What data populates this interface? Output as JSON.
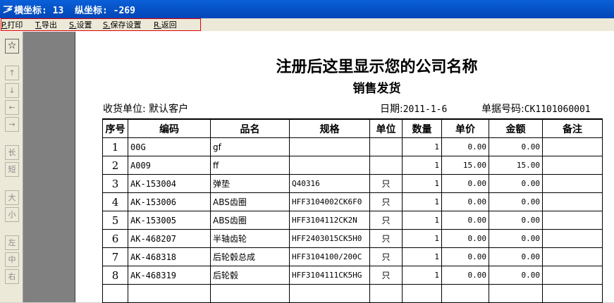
{
  "titlebar": {
    "text": "横坐标: 13  纵坐标: -269"
  },
  "menu": [
    {
      "key": "P.",
      "label": "打印"
    },
    {
      "key": "T.",
      "label": "导出"
    },
    {
      "key": "S.",
      "label": "设置"
    },
    {
      "key": "S.",
      "label": "保存设置"
    },
    {
      "key": "R.",
      "label": "返回"
    }
  ],
  "toolbox": {
    "star": "☆",
    "up": "↑",
    "down": "↓",
    "left": "←",
    "right": "→",
    "long": "长",
    "short": "短",
    "big": "大",
    "small": "小",
    "align_left": "左",
    "align_center": "中",
    "align_right": "右"
  },
  "doc": {
    "company": "注册后这里显示您的公司名称",
    "title": "销售发货",
    "receiver_label": "收货单位:",
    "receiver": "默认客户",
    "date_label": "日期:",
    "date": "2011-1-6",
    "docno_label": "单据号码:",
    "docno": "CK1101060001"
  },
  "table": {
    "headers": [
      "序号",
      "编码",
      "品名",
      "规格",
      "单位",
      "数量",
      "单价",
      "金额",
      "备注"
    ],
    "rows": [
      {
        "no": "1",
        "code": "00G",
        "name": "gf",
        "spec": "",
        "unit": "",
        "qty": "1",
        "price": "0.00",
        "amount": "0.00",
        "note": ""
      },
      {
        "no": "2",
        "code": "A009",
        "name": "ff",
        "spec": "",
        "unit": "",
        "qty": "1",
        "price": "15.00",
        "amount": "15.00",
        "note": ""
      },
      {
        "no": "3",
        "code": "AK-153004",
        "name": "弹垫",
        "spec": "Q40316",
        "unit": "只",
        "qty": "1",
        "price": "0.00",
        "amount": "0.00",
        "note": ""
      },
      {
        "no": "4",
        "code": "AK-153006",
        "name": "ABS齿圈",
        "spec": "HFF3104002CK6F0",
        "unit": "只",
        "qty": "1",
        "price": "0.00",
        "amount": "0.00",
        "note": ""
      },
      {
        "no": "5",
        "code": "AK-153005",
        "name": "ABS齿圈",
        "spec": "HFF3104112CK2N",
        "unit": "只",
        "qty": "1",
        "price": "0.00",
        "amount": "0.00",
        "note": ""
      },
      {
        "no": "6",
        "code": "AK-468207",
        "name": "半轴齿轮",
        "spec": "HFF2403015CK5H0",
        "unit": "只",
        "qty": "1",
        "price": "0.00",
        "amount": "0.00",
        "note": ""
      },
      {
        "no": "7",
        "code": "AK-468318",
        "name": "后轮毂总成",
        "spec": "HFF3104100/200C",
        "unit": "只",
        "qty": "1",
        "price": "0.00",
        "amount": "0.00",
        "note": ""
      },
      {
        "no": "8",
        "code": "AK-468319",
        "name": "后轮毂",
        "spec": "HFF3104111CK5HG",
        "unit": "只",
        "qty": "1",
        "price": "0.00",
        "amount": "0.00",
        "note": ""
      }
    ]
  }
}
